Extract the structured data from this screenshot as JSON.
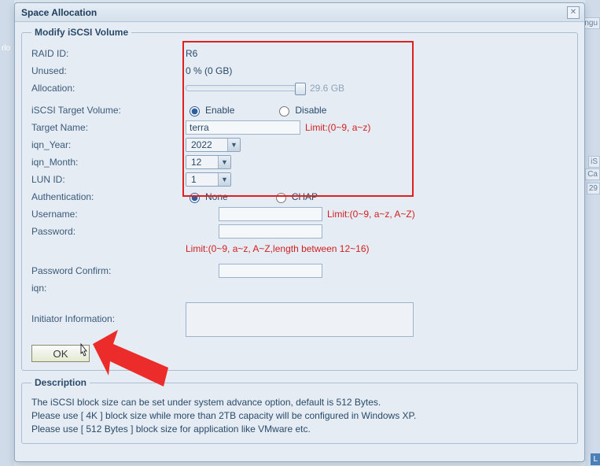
{
  "window": {
    "title": "Space Allocation"
  },
  "modify": {
    "legend": "Modify iSCSI Volume",
    "raid_id_label": "RAID ID:",
    "raid_id_value": "R6",
    "unused_label": "Unused:",
    "unused_value": "0 % (0 GB)",
    "allocation_label": "Allocation:",
    "allocation_value": "29.6 GB",
    "target_volume_label": "iSCSI Target Volume:",
    "enable_label": "Enable",
    "disable_label": "Disable",
    "target_name_label": "Target Name:",
    "target_name_value": "terra",
    "target_name_limit": "Limit:(0~9, a~z)",
    "year_label": "iqn_Year:",
    "year_value": "2022",
    "month_label": "iqn_Month:",
    "month_value": "12",
    "lun_label": "LUN ID:",
    "lun_value": "1",
    "auth_label": "Authentication:",
    "auth_none": "None",
    "auth_chap": "CHAP",
    "username_label": "Username:",
    "username_limit": "Limit:(0~9, a~z, A~Z)",
    "password_label": "Password:",
    "password_limit": "Limit:(0~9, a~z, A~Z,length between 12~16)",
    "password_confirm_label": "Password Confirm:",
    "iqn_label": "iqn:",
    "initiator_label": "Initiator Information:",
    "ok_label": "OK"
  },
  "description": {
    "legend": "Description",
    "line1": "The iSCSI block size can be set under system advance option, default is 512 Bytes.",
    "line2": "Please use [ 4K ] block size while more than 2TB capacity will be configured in Windows XP.",
    "line3": "Please use [ 512 Bytes ] block size for application like VMware etc."
  },
  "bg": {
    "left": "rlo",
    "right1": "ingu",
    "right2": "iS",
    "right3": "Ca",
    "right4": "29",
    "right5": "L"
  }
}
